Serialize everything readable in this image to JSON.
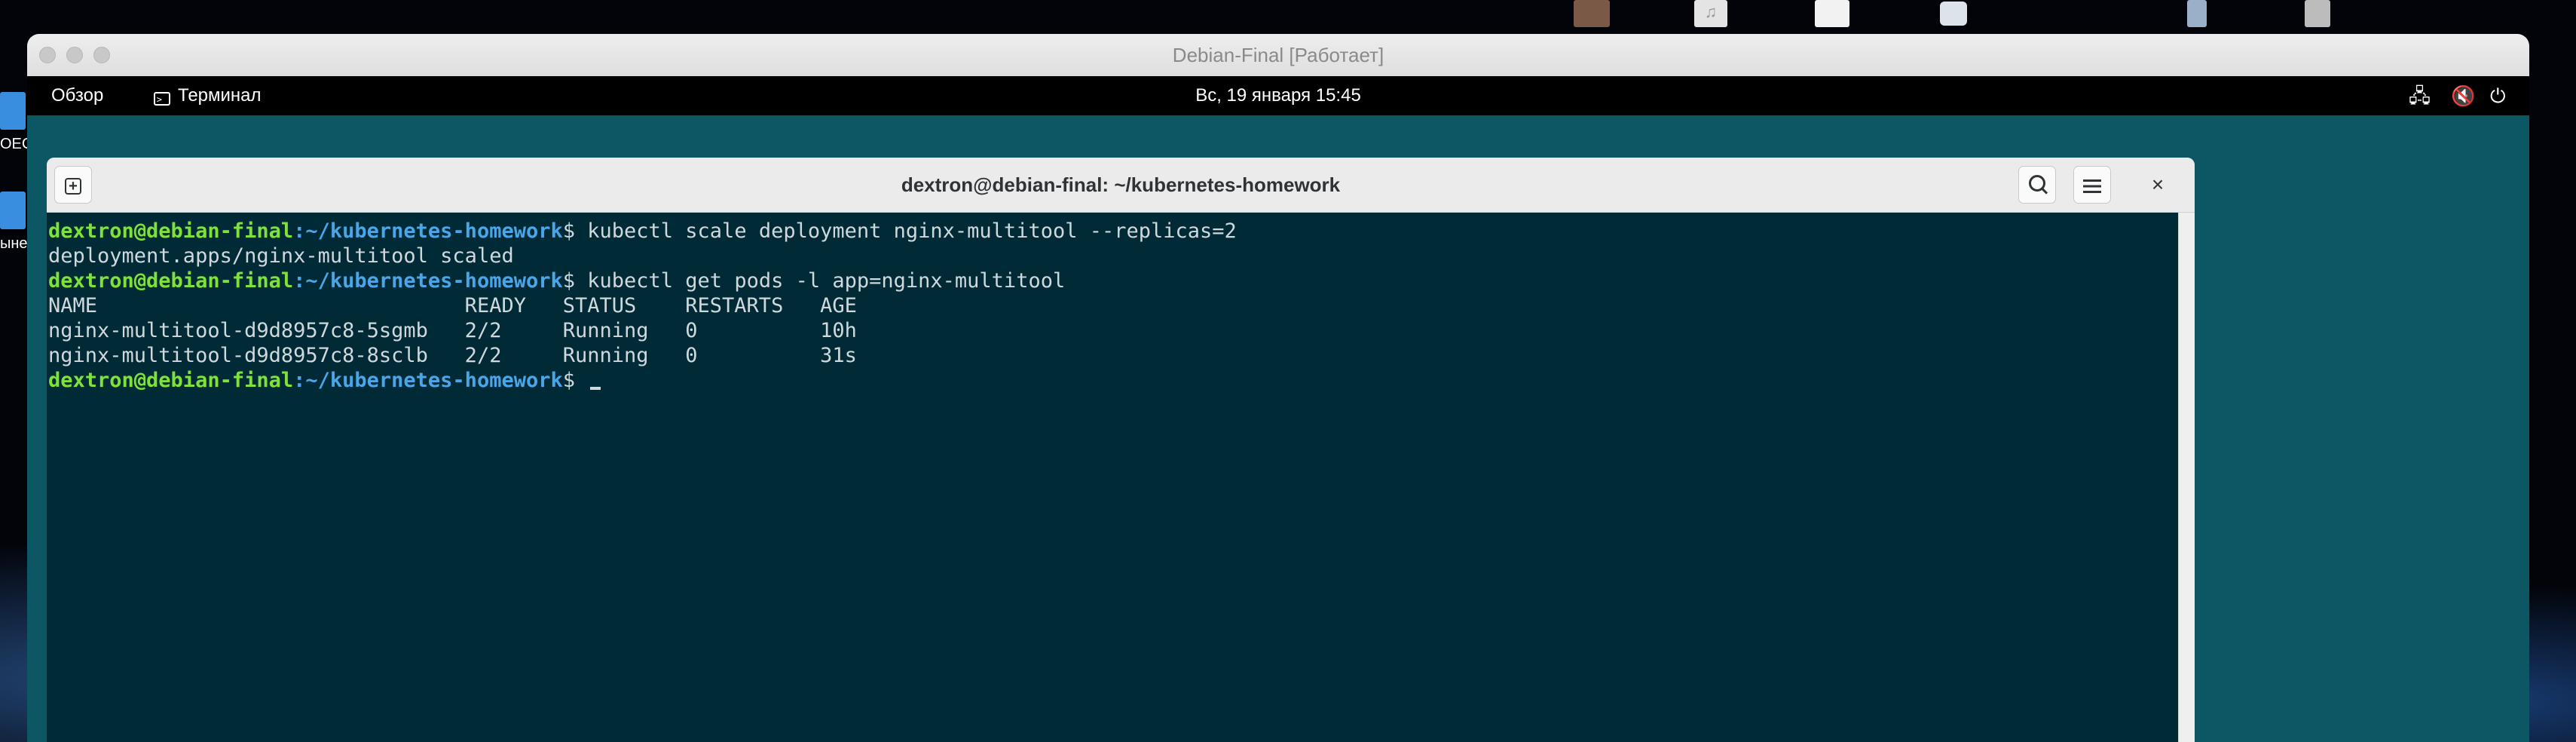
{
  "host": {
    "top_icons": [
      "photo-thumbnail-icon",
      "music-file-icon",
      "document-file-icon",
      "app-icon",
      "file-icon",
      "file-icon"
    ],
    "desktop_labels": [
      "ОЕС",
      "ынегу"
    ]
  },
  "vm": {
    "title": "Debian-Final [Работает]"
  },
  "gnome": {
    "overview": "Обзор",
    "app_menu": "Терминал",
    "clock": "Вс, 19 января  15:45"
  },
  "terminal": {
    "title": "dextron@debian-final: ~/kubernetes-homework",
    "prompt_user": "dextron@debian-final",
    "prompt_path": ":~/kubernetes-homework",
    "prompt_end": "$ ",
    "cmd1": "kubectl scale deployment nginx-multitool --replicas=2",
    "out1": "deployment.apps/nginx-multitool scaled",
    "cmd2": "kubectl get pods -l app=nginx-multitool",
    "table_header": "NAME                              READY   STATUS    RESTARTS   AGE",
    "rows": [
      "nginx-multitool-d9d8957c8-5sgmb   2/2     Running   0          10h",
      "nginx-multitool-d9d8957c8-8sclb   2/2     Running   0          31s"
    ]
  },
  "colors": {
    "terminal_bg": "#002b36",
    "prompt_user": "#7ee23a",
    "prompt_path": "#4aa6e8",
    "desktop_teal": "#0d5663"
  }
}
